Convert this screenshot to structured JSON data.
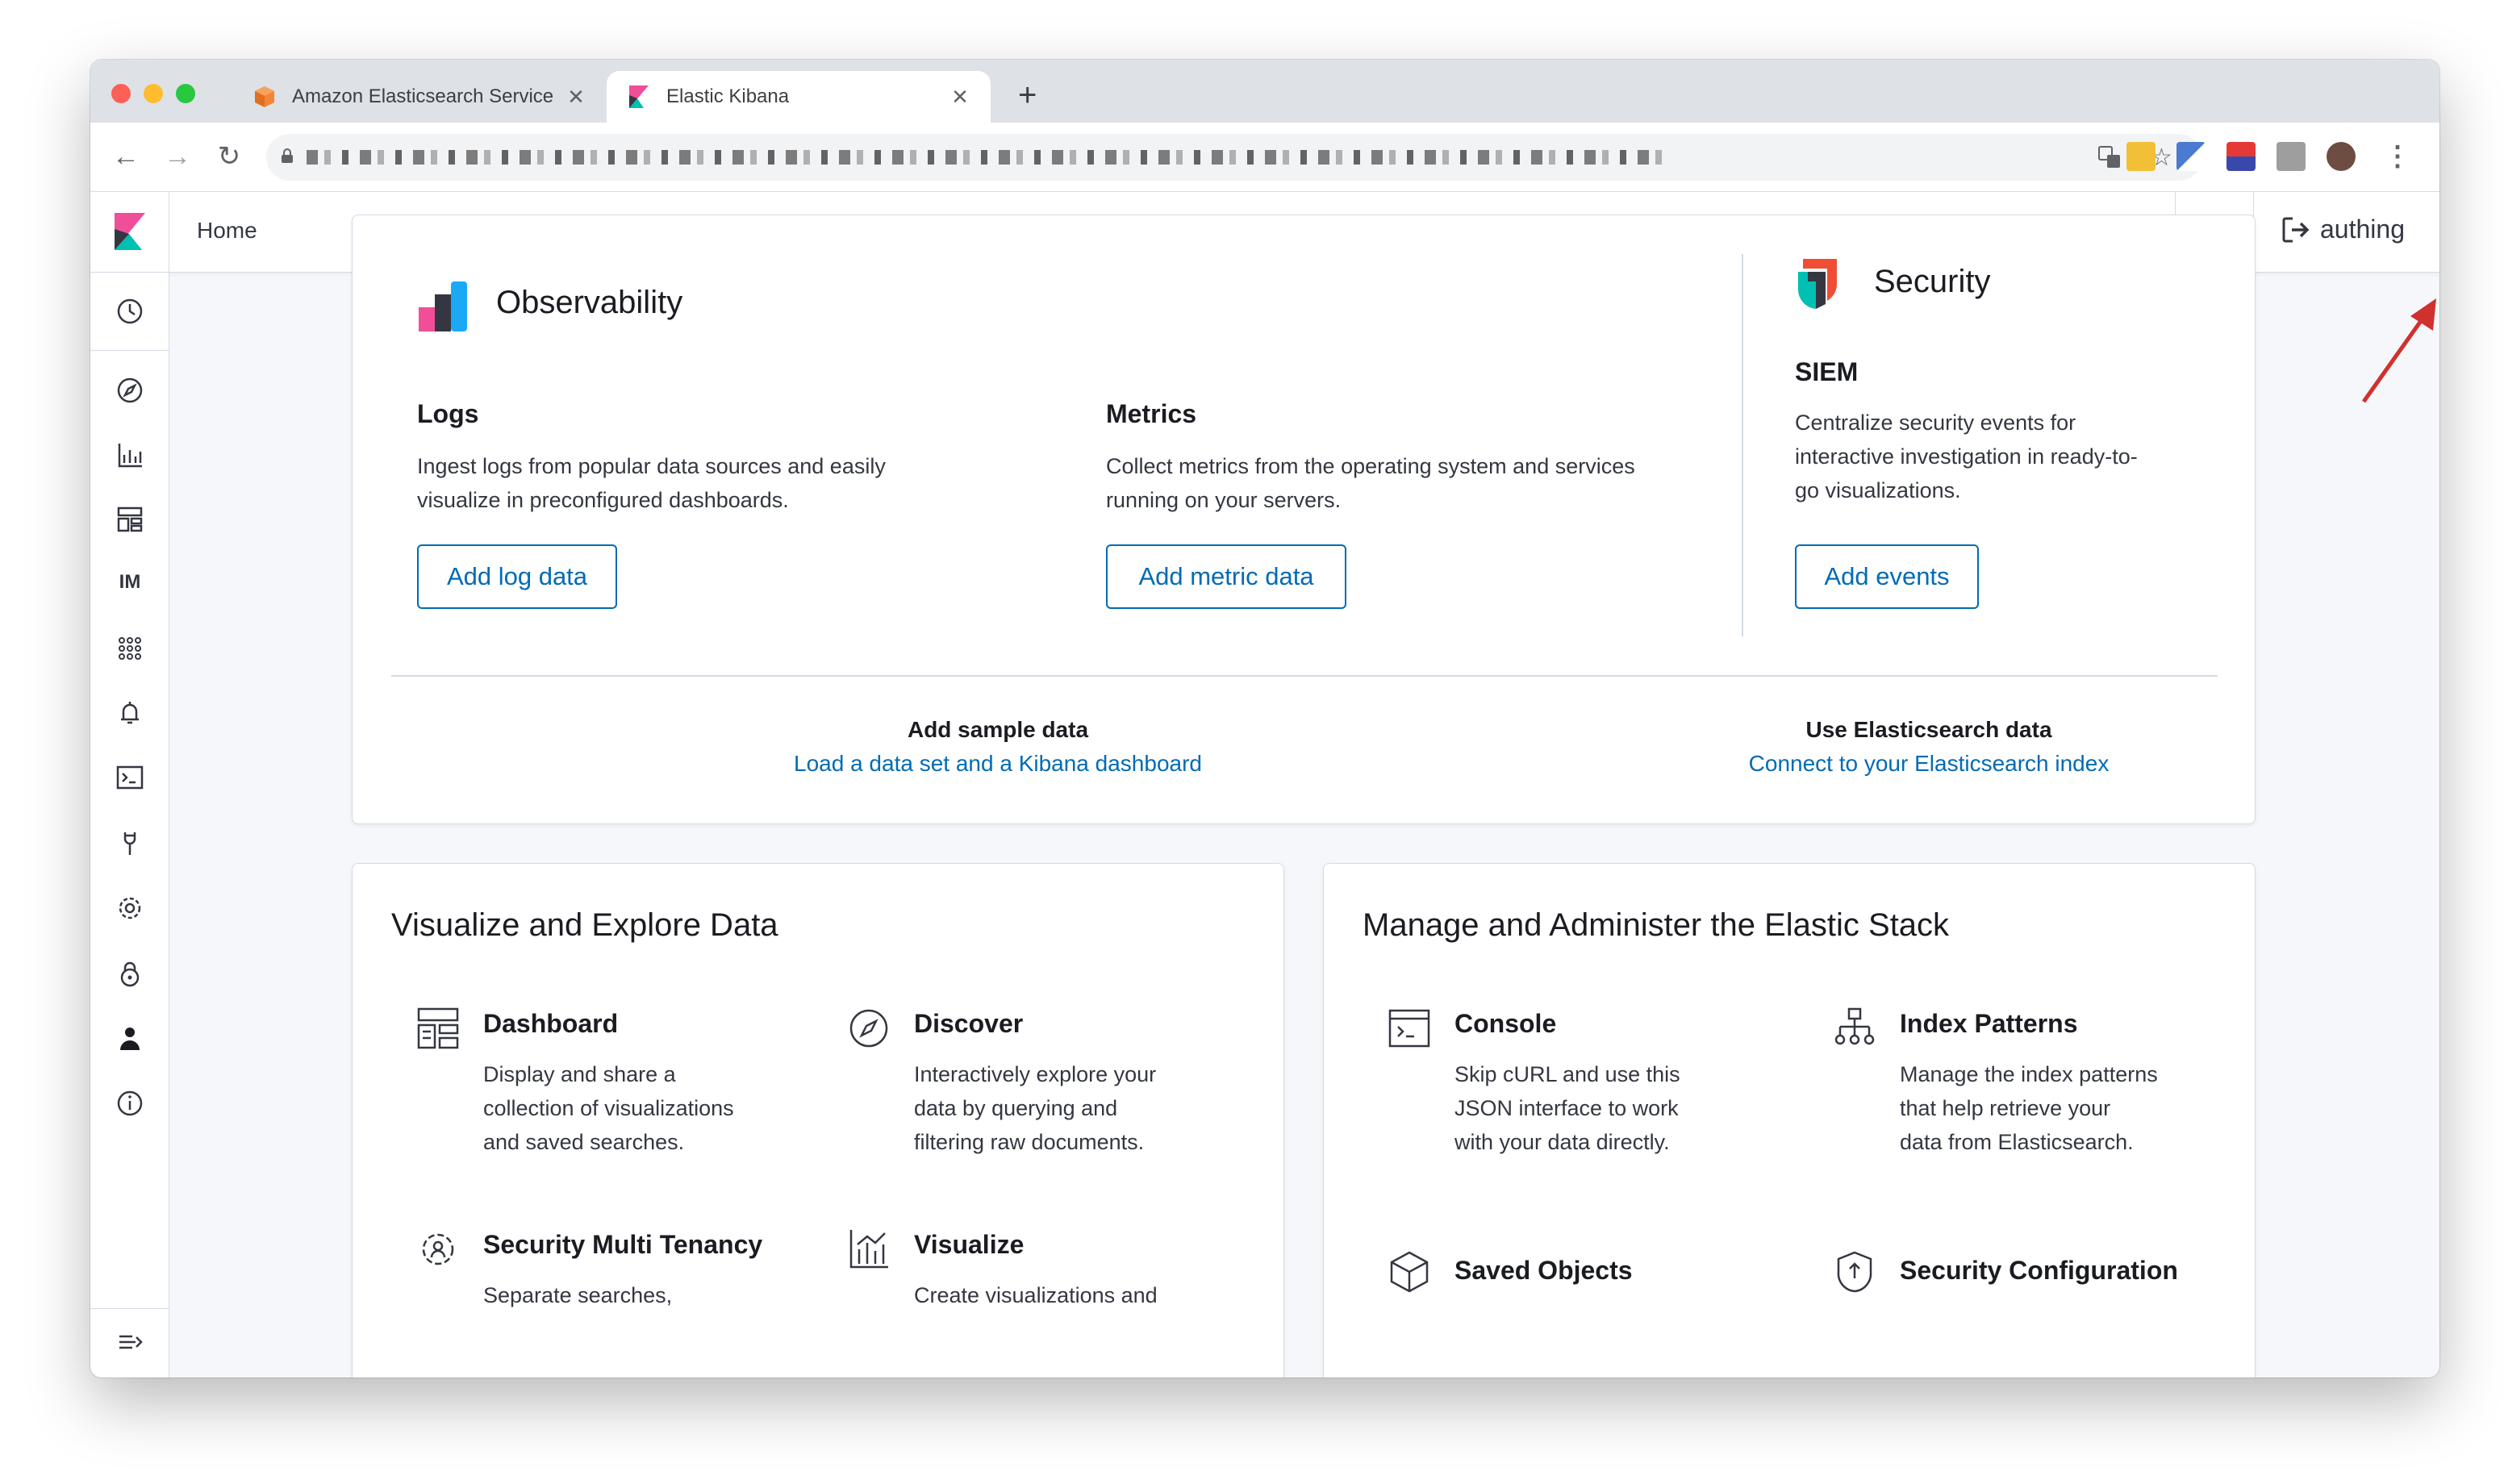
{
  "browser": {
    "tabs": [
      {
        "title": "Amazon Elasticsearch Service",
        "close": "✕"
      },
      {
        "title": "Elastic Kibana",
        "close": "✕"
      }
    ],
    "new_tab": "+",
    "nav": {
      "back": "←",
      "forward": "→",
      "reload": "↻"
    },
    "star": "☆",
    "menu": "⋮"
  },
  "kibana": {
    "breadcrumb": "Home",
    "user": "authing",
    "nav_text_item": "IM"
  },
  "observability": {
    "title": "Observability",
    "logs": {
      "title": "Logs",
      "desc_lines": [
        "Ingest logs from popular data sources and easily",
        "visualize in preconfigured dashboards."
      ],
      "button": "Add log data"
    },
    "metrics": {
      "title": "Metrics",
      "desc_lines": [
        "Collect metrics from the operating system and services",
        "running on your servers."
      ],
      "button": "Add metric data"
    },
    "security": {
      "title": "Security",
      "subtitle": "SIEM",
      "desc_lines": [
        "Centralize security events for",
        "interactive investigation in ready-to-",
        "go visualizations."
      ],
      "button": "Add events"
    },
    "sample": {
      "title": "Add sample data",
      "link": "Load a data set and a Kibana dashboard"
    },
    "es_data": {
      "title": "Use Elasticsearch data",
      "link": "Connect to your Elasticsearch index"
    }
  },
  "visualize": {
    "title": "Visualize and Explore Data",
    "items": [
      {
        "title": "Dashboard",
        "desc_lines": [
          "Display and share a",
          "collection of visualizations",
          "and saved searches."
        ]
      },
      {
        "title": "Discover",
        "desc_lines": [
          "Interactively explore your",
          "data by querying and",
          "filtering raw documents."
        ]
      },
      {
        "title": "Security Multi Tenancy",
        "desc_lines": [
          "Separate searches,"
        ]
      },
      {
        "title": "Visualize",
        "desc_lines": [
          "Create visualizations and"
        ]
      }
    ]
  },
  "manage": {
    "title": "Manage and Administer the Elastic Stack",
    "items": [
      {
        "title": "Console",
        "desc_lines": [
          "Skip cURL and use this",
          "JSON interface to work",
          "with your data directly."
        ]
      },
      {
        "title": "Index Patterns",
        "desc_lines": [
          "Manage the index patterns",
          "that help retrieve your",
          "data from Elasticsearch."
        ]
      },
      {
        "title": "Saved Objects",
        "desc_lines": []
      },
      {
        "title": "Security Configuration",
        "desc_lines": []
      }
    ]
  },
  "colors": {
    "link": "#006bb4",
    "annotation_arrow": "#d0312d",
    "kibana_pink": "#f04e98",
    "kibana_teal": "#00bfb3"
  }
}
